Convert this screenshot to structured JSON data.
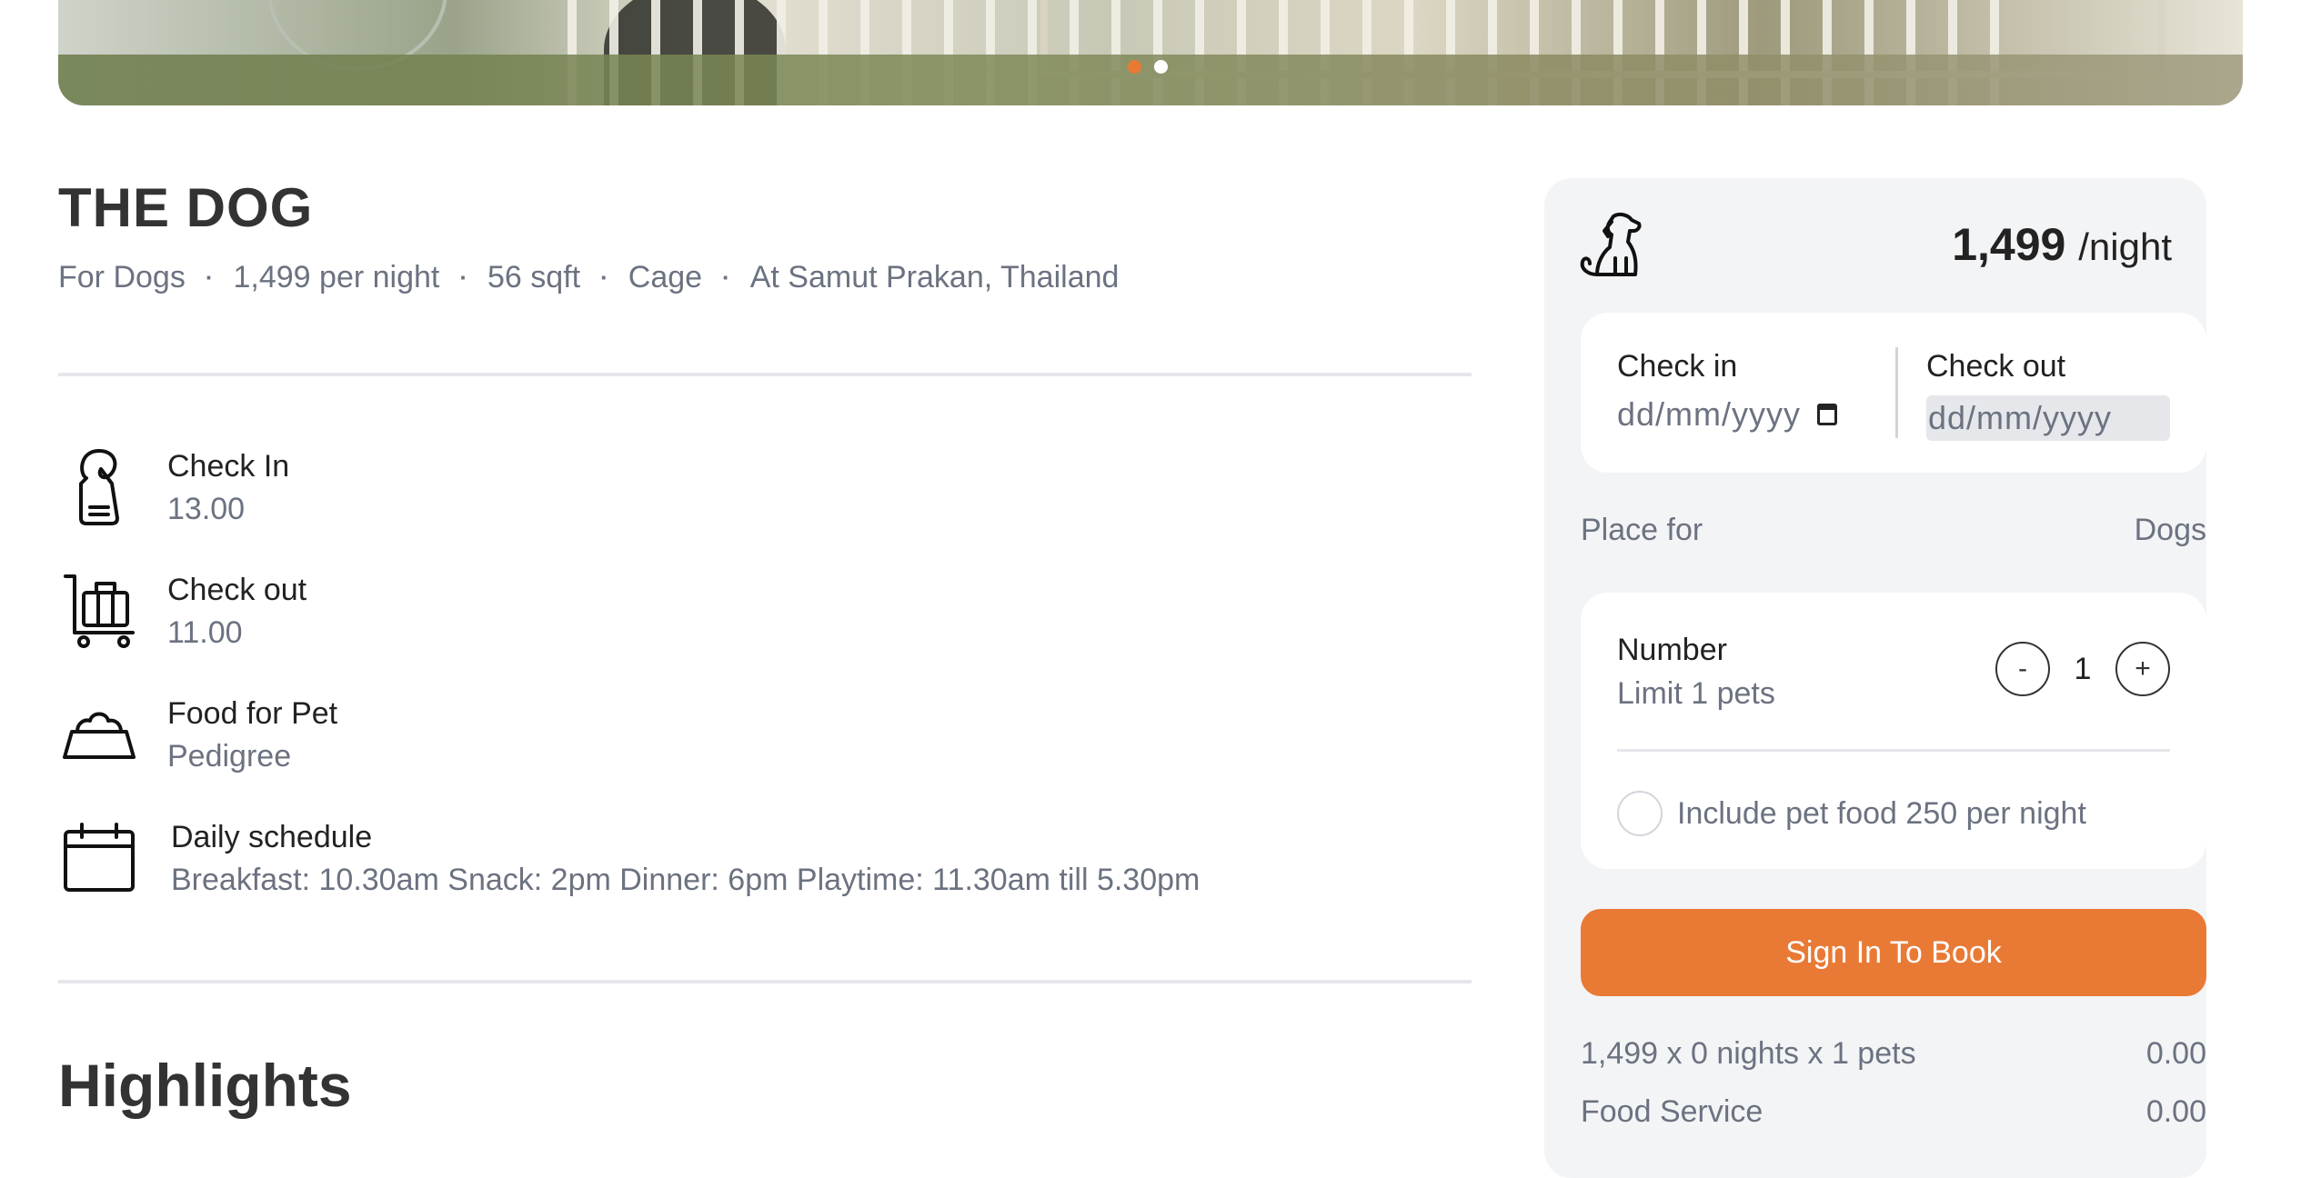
{
  "hero": {
    "slide_count": 2,
    "active_slide": 1
  },
  "listing": {
    "title": "THE DOG",
    "meta": [
      "For Dogs",
      "1,499 per night",
      "56 sqft",
      "Cage",
      "At Samut Prakan, Thailand"
    ]
  },
  "features": [
    {
      "icon": "door-hanger-icon",
      "label": "Check In",
      "value": "13.00"
    },
    {
      "icon": "luggage-cart-icon",
      "label": "Check out",
      "value": "11.00"
    },
    {
      "icon": "pet-bowl-icon",
      "label": "Food for Pet",
      "value": "Pedigree"
    },
    {
      "icon": "calendar-icon",
      "label": "Daily schedule",
      "value": "Breakfast: 10.30am Snack: 2pm Dinner: 6pm Playtime: 11.30am till 5.30pm"
    }
  ],
  "highlights_title": "Highlights",
  "booking": {
    "icon": "dog-icon",
    "price": "1,499",
    "price_unit": "/night",
    "check_in_label": "Check in",
    "check_in_placeholder": "dd/mm/yyyy",
    "check_out_label": "Check out",
    "check_out_placeholder": "dd/mm/yyyy",
    "place_for_label": "Place for",
    "place_for_value": "Dogs",
    "number_label": "Number",
    "number_limit": "Limit 1 pets",
    "decrement": "-",
    "quantity": "1",
    "increment": "+",
    "food_option": "Include pet food 250 per night",
    "book_button": "Sign In To Book",
    "summary": [
      {
        "label": "1,499 x 0 nights x 1 pets",
        "amount": "0.00"
      },
      {
        "label": "Food Service",
        "amount": "0.00"
      }
    ]
  },
  "colors": {
    "accent": "#e97a35",
    "muted_text": "#6b7280",
    "card_bg": "#f3f4f6"
  }
}
